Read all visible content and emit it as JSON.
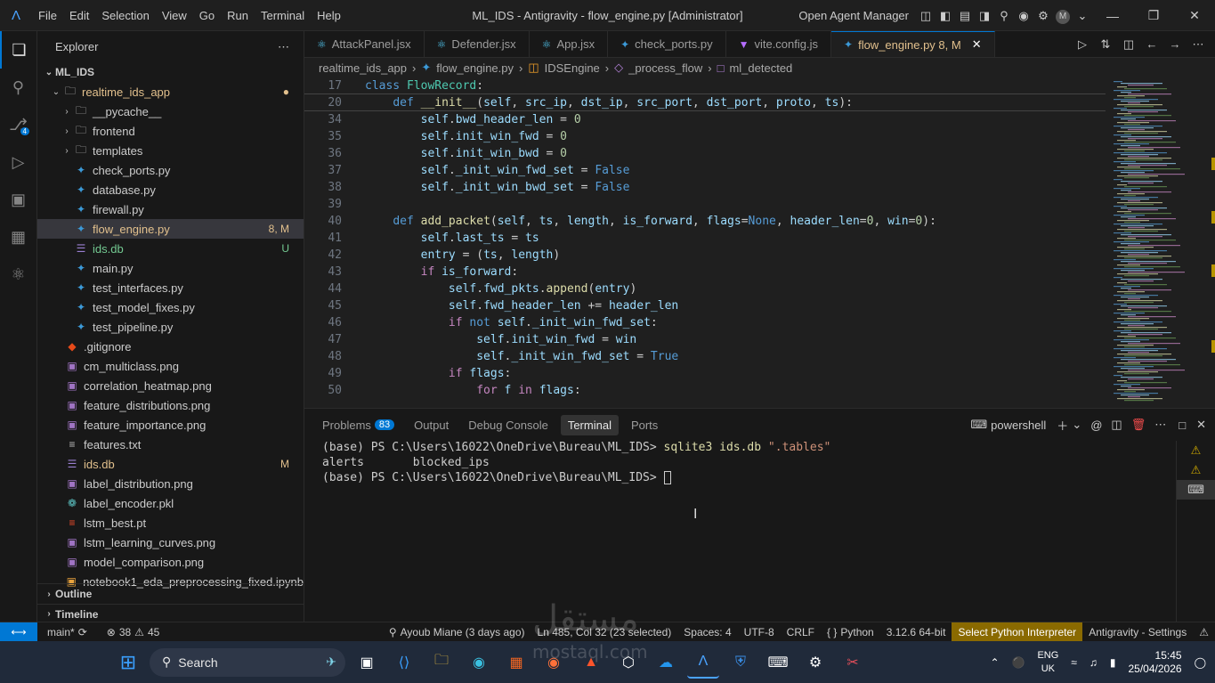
{
  "titlebar": {
    "menu": [
      "File",
      "Edit",
      "Selection",
      "View",
      "Go",
      "Run",
      "Terminal",
      "Help"
    ],
    "title": "ML_IDS - Antigravity - flow_engine.py [Administrator]",
    "open_agent_manager": "Open Agent Manager",
    "avatar": "M"
  },
  "explorer": {
    "header": "Explorer",
    "root": "ML_IDS",
    "folder": "realtime_ids_app",
    "items": [
      {
        "name": "__pycache__",
        "kind": "folder-open",
        "deco": ""
      },
      {
        "name": "frontend",
        "kind": "folder",
        "deco": ""
      },
      {
        "name": "templates",
        "kind": "folder",
        "deco": ""
      },
      {
        "name": "check_ports.py",
        "kind": "py",
        "deco": ""
      },
      {
        "name": "database.py",
        "kind": "py",
        "deco": ""
      },
      {
        "name": "firewall.py",
        "kind": "py",
        "deco": ""
      },
      {
        "name": "flow_engine.py",
        "kind": "py",
        "deco": "8, M"
      },
      {
        "name": "ids.db",
        "kind": "db",
        "deco": "U"
      },
      {
        "name": "main.py",
        "kind": "py",
        "deco": ""
      },
      {
        "name": "test_interfaces.py",
        "kind": "py",
        "deco": ""
      },
      {
        "name": "test_model_fixes.py",
        "kind": "py",
        "deco": ""
      },
      {
        "name": "test_pipeline.py",
        "kind": "py",
        "deco": ""
      }
    ],
    "root_items": [
      {
        "name": ".gitignore",
        "kind": "git",
        "deco": ""
      },
      {
        "name": "cm_multiclass.png",
        "kind": "img",
        "deco": ""
      },
      {
        "name": "correlation_heatmap.png",
        "kind": "img",
        "deco": ""
      },
      {
        "name": "feature_distributions.png",
        "kind": "img",
        "deco": ""
      },
      {
        "name": "feature_importance.png",
        "kind": "img",
        "deco": ""
      },
      {
        "name": "features.txt",
        "kind": "txt",
        "deco": ""
      },
      {
        "name": "ids.db",
        "kind": "db",
        "deco": "M"
      },
      {
        "name": "label_distribution.png",
        "kind": "img",
        "deco": ""
      },
      {
        "name": "label_encoder.pkl",
        "kind": "pkl",
        "deco": ""
      },
      {
        "name": "lstm_best.pt",
        "kind": "pt",
        "deco": ""
      },
      {
        "name": "lstm_learning_curves.png",
        "kind": "img",
        "deco": ""
      },
      {
        "name": "model_comparison.png",
        "kind": "img",
        "deco": ""
      },
      {
        "name": "notebook1_eda_preprocessing_fixed.ipynb",
        "kind": "nb",
        "deco": ""
      }
    ],
    "outline": "Outline",
    "timeline": "Timeline"
  },
  "tabs": [
    {
      "label": "AttackPanel.jsx",
      "active": false
    },
    {
      "label": "Defender.jsx",
      "active": false
    },
    {
      "label": "App.jsx",
      "active": false
    },
    {
      "label": "check_ports.py",
      "active": false
    },
    {
      "label": "vite.config.js",
      "active": false
    },
    {
      "label": "flow_engine.py 8, M",
      "active": true
    }
  ],
  "breadcrumb": [
    "realtime_ids_app",
    "flow_engine.py",
    "IDSEngine",
    "_process_flow",
    "ml_detected"
  ],
  "code": [
    {
      "n": "17",
      "html": "<span class='k'>class</span> <span class='c'>FlowRecord</span>:"
    },
    {
      "n": "20",
      "html": "    <span class='k'>def</span> <span class='f'>__init__</span>(<span class='p'>self</span>, <span class='p'>src_ip</span>, <span class='p'>dst_ip</span>, <span class='p'>src_port</span>, <span class='p'>dst_port</span>, <span class='p'>proto</span>, <span class='p'>ts</span>):"
    },
    {
      "n": "34",
      "html": "        <span class='p'>self</span>.<span class='p'>bwd_header_len</span> = <span class='n'>0</span>"
    },
    {
      "n": "35",
      "html": "        <span class='p'>self</span>.<span class='p'>init_win_fwd</span> = <span class='n'>0</span>"
    },
    {
      "n": "36",
      "html": "        <span class='p'>self</span>.<span class='p'>init_win_bwd</span> = <span class='n'>0</span>"
    },
    {
      "n": "37",
      "html": "        <span class='p'>self</span>.<span class='p'>_init_win_fwd_set</span> = <span class='k'>False</span>"
    },
    {
      "n": "38",
      "html": "        <span class='p'>self</span>.<span class='p'>_init_win_bwd_set</span> = <span class='k'>False</span>"
    },
    {
      "n": "39",
      "html": ""
    },
    {
      "n": "40",
      "html": "    <span class='k'>def</span> <span class='f'>add_packet</span>(<span class='p'>self</span>, <span class='p'>ts</span>, <span class='p'>length</span>, <span class='p'>is_forward</span>, <span class='p'>flags</span>=<span class='k'>None</span>, <span class='p'>header_len</span>=<span class='n'>0</span>, <span class='p'>win</span>=<span class='n'>0</span>):"
    },
    {
      "n": "41",
      "html": "        <span class='p'>self</span>.<span class='p'>last_ts</span> = <span class='p'>ts</span>"
    },
    {
      "n": "42",
      "html": "        <span class='p'>entry</span> = (<span class='p'>ts</span>, <span class='p'>length</span>)"
    },
    {
      "n": "43",
      "html": "        <span class='kc'>if</span> <span class='p'>is_forward</span>:"
    },
    {
      "n": "44",
      "html": "            <span class='p'>self</span>.<span class='p'>fwd_pkts</span>.<span class='f'>append</span>(<span class='p'>entry</span>)"
    },
    {
      "n": "45",
      "html": "            <span class='p'>self</span>.<span class='p'>fwd_header_len</span> += <span class='p'>header_len</span>"
    },
    {
      "n": "46",
      "html": "            <span class='kc'>if</span> <span class='k'>not</span> <span class='p'>self</span>.<span class='p'>_init_win_fwd_set</span>:"
    },
    {
      "n": "47",
      "html": "                <span class='p'>self</span>.<span class='p'>init_win_fwd</span> = <span class='p'>win</span>"
    },
    {
      "n": "48",
      "html": "                <span class='p'>self</span>.<span class='p'>_init_win_fwd_set</span> = <span class='k'>True</span>"
    },
    {
      "n": "49",
      "html": "            <span class='kc'>if</span> <span class='p'>flags</span>:"
    },
    {
      "n": "50",
      "html": "                <span class='kc'>for</span> <span class='p'>f</span> <span class='kc'>in</span> <span class='p'>flags</span>:"
    }
  ],
  "panel": {
    "tabs": [
      "Problems",
      "Output",
      "Debug Console",
      "Terminal",
      "Ports"
    ],
    "problems_count": "83",
    "shell": "powershell",
    "terminal_lines": [
      {
        "prompt": "(base) PS C:\\Users\\16022\\OneDrive\\Bureau\\ML_IDS> ",
        "cmd": "sqlite3 ids.db",
        "arg": " \".tables\""
      },
      {
        "prompt": "alerts       blocked_ips",
        "cmd": "",
        "arg": ""
      },
      {
        "prompt": "(base) PS C:\\Users\\16022\\OneDrive\\Bureau\\ML_IDS> ",
        "cmd": "",
        "arg": ""
      }
    ]
  },
  "statusbar": {
    "branch": "main*",
    "errors": "38",
    "warnings": "45",
    "blame": "Ayoub Miane (3 days ago)",
    "position": "Ln 485, Col 32 (23 selected)",
    "spaces": "Spaces: 4",
    "encoding": "UTF-8",
    "eol": "CRLF",
    "language": "Python",
    "interpreter_version": "3.12.6 64-bit",
    "select_interpreter": "Select Python Interpreter",
    "settings": "Antigravity - Settings"
  },
  "taskbar": {
    "search": "Search",
    "lang_top": "ENG",
    "lang_bottom": "UK",
    "time": "15:45",
    "date": "25/04/2026"
  },
  "watermark": "مستقل",
  "watermark_latin": "mostaql.com",
  "colors": {
    "accent": "#0078d4",
    "warning": "#8a6a00"
  }
}
